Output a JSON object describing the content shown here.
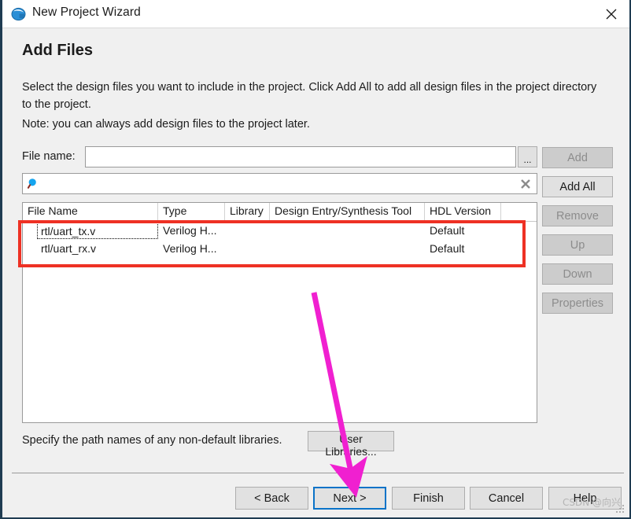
{
  "window": {
    "title": "New Project Wizard",
    "icon": "quartus-globe-icon",
    "close_label": "close-icon"
  },
  "page": {
    "heading": "Add Files",
    "description_line1": "Select the design files you want to include in the project. Click Add All to add all design files in the project directory to the project.",
    "description_line2": "Note: you can always add design files to the project later."
  },
  "filename_row": {
    "label": "File name:",
    "value": "",
    "placeholder": "",
    "browse_label": "..."
  },
  "search_row": {
    "value": "",
    "placeholder": "",
    "icon": "search-icon",
    "clear_icon": "clear-icon"
  },
  "table": {
    "columns": [
      "File Name",
      "Type",
      "Library",
      "Design Entry/Synthesis Tool",
      "HDL Version"
    ],
    "rows": [
      {
        "file_name": "rtl/uart_tx.v",
        "type": "Verilog H...",
        "library": "",
        "design_entry": "",
        "hdl_version": "Default"
      },
      {
        "file_name": "rtl/uart_rx.v",
        "type": "Verilog H...",
        "library": "",
        "design_entry": "",
        "hdl_version": "Default"
      }
    ]
  },
  "side_buttons": [
    {
      "label": "Add",
      "enabled": false
    },
    {
      "label": "Add All",
      "enabled": true
    },
    {
      "label": "Remove",
      "enabled": false
    },
    {
      "label": "Up",
      "enabled": false
    },
    {
      "label": "Down",
      "enabled": false
    },
    {
      "label": "Properties",
      "enabled": false
    }
  ],
  "libraries_row": {
    "text": "Specify the path names of any non-default libraries.",
    "button_label": "User Libraries..."
  },
  "footer_buttons": [
    {
      "label": "< Back",
      "focused": false
    },
    {
      "label": "Next >",
      "focused": true
    },
    {
      "label": "Finish",
      "focused": false
    },
    {
      "label": "Cancel",
      "focused": false
    },
    {
      "label": "Help",
      "focused": false
    }
  ],
  "annotations": {
    "highlight_color": "#ee3124",
    "arrow_color": "#f020d0",
    "focus_color": "#0a73c8"
  },
  "watermark": "CSDN @向兴"
}
